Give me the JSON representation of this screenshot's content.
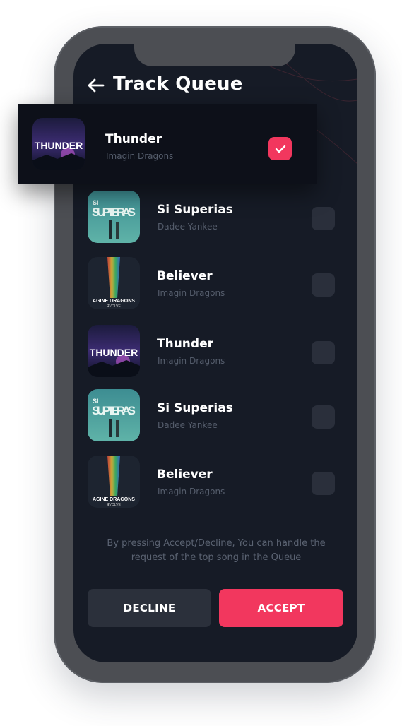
{
  "header": {
    "title": "Track Queue",
    "back_icon": "arrow-left-icon"
  },
  "featured": {
    "title": "Thunder",
    "artist": "Imagin Dragons",
    "art_text": "THUNDER",
    "checked": true
  },
  "queue": [
    {
      "title": "Si Superias",
      "artist": "Dadee Yankee",
      "art": "superias",
      "art_text": "SUPTERAS",
      "art_small": "SI"
    },
    {
      "title": "Believer",
      "artist": "Imagin Dragons",
      "art": "believer",
      "art_text": "AGINE DRAGONS",
      "art_sub": "ƎVOLVE"
    },
    {
      "title": "Thunder",
      "artist": "Imagin Dragons",
      "art": "thunder",
      "art_text": "THUNDER"
    },
    {
      "title": "Si Superias",
      "artist": "Dadee Yankee",
      "art": "superias",
      "art_text": "SUPTERAS",
      "art_small": "SI"
    },
    {
      "title": "Believer",
      "artist": "Imagin Dragons",
      "art": "believer",
      "art_text": "AGINE DRAGONS",
      "art_sub": "ƎVOLVE"
    }
  ],
  "hint": "By pressing Accept/Decline, You can handle the request of the top song in the Queue",
  "actions": {
    "decline": "DECLINE",
    "accept": "ACCEPT"
  },
  "colors": {
    "background": "#161b26",
    "accent": "#f2375e",
    "frame": "#4c4e53",
    "muted_text": "#555d6c"
  }
}
